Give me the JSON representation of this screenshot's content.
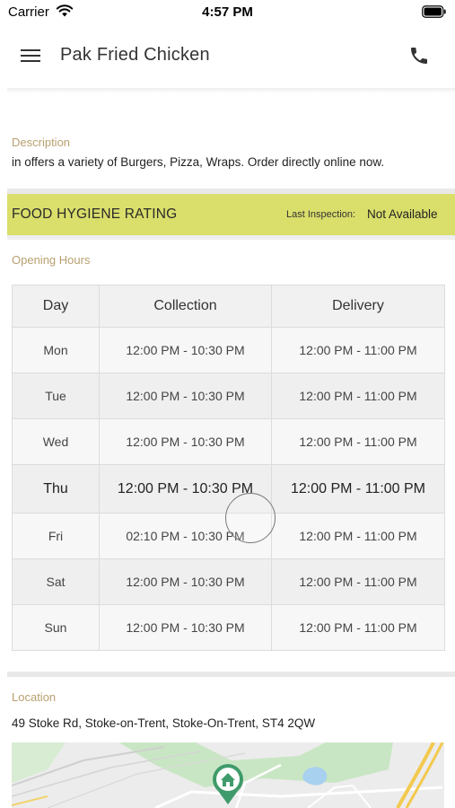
{
  "status_bar": {
    "carrier": "Carrier",
    "time": "4:57 PM"
  },
  "header": {
    "title": "Pak Fried Chicken",
    "menu_icon": "hamburger-menu-icon",
    "phone_icon": "phone-icon"
  },
  "description": {
    "label": "Description",
    "text": "in  offers a variety of Burgers, Pizza, Wraps. Order directly online now."
  },
  "hygiene": {
    "title": "FOOD HYGIENE RATING",
    "last_inspection_label": "Last Inspection:",
    "last_inspection_value": "Not Available",
    "color": "#dade6b"
  },
  "opening_hours": {
    "label": "Opening Hours",
    "columns": [
      "Day",
      "Collection",
      "Delivery"
    ],
    "rows": [
      {
        "day": "Mon",
        "collection": "12:00 PM - 10:30 PM",
        "delivery": "12:00 PM - 11:00 PM"
      },
      {
        "day": "Tue",
        "collection": "12:00 PM - 10:30 PM",
        "delivery": "12:00 PM - 11:00 PM"
      },
      {
        "day": "Wed",
        "collection": "12:00 PM - 10:30 PM",
        "delivery": "12:00 PM - 11:00 PM"
      },
      {
        "day": "Thu",
        "collection": "12:00 PM - 10:30 PM",
        "delivery": "12:00 PM - 11:00 PM"
      },
      {
        "day": "Fri",
        "collection": "02:10 PM - 10:30 PM",
        "delivery": "12:00 PM - 11:00 PM"
      },
      {
        "day": "Sat",
        "collection": "12:00 PM - 10:30 PM",
        "delivery": "12:00 PM - 11:00 PM"
      },
      {
        "day": "Sun",
        "collection": "12:00 PM - 10:30 PM",
        "delivery": "12:00 PM - 11:00 PM"
      }
    ]
  },
  "location": {
    "label": "Location",
    "address": "49 Stoke Rd, Stoke-on-Trent, Stoke-On-Trent, ST4 2QW",
    "map_pin_icon": "home-map-pin-icon"
  }
}
